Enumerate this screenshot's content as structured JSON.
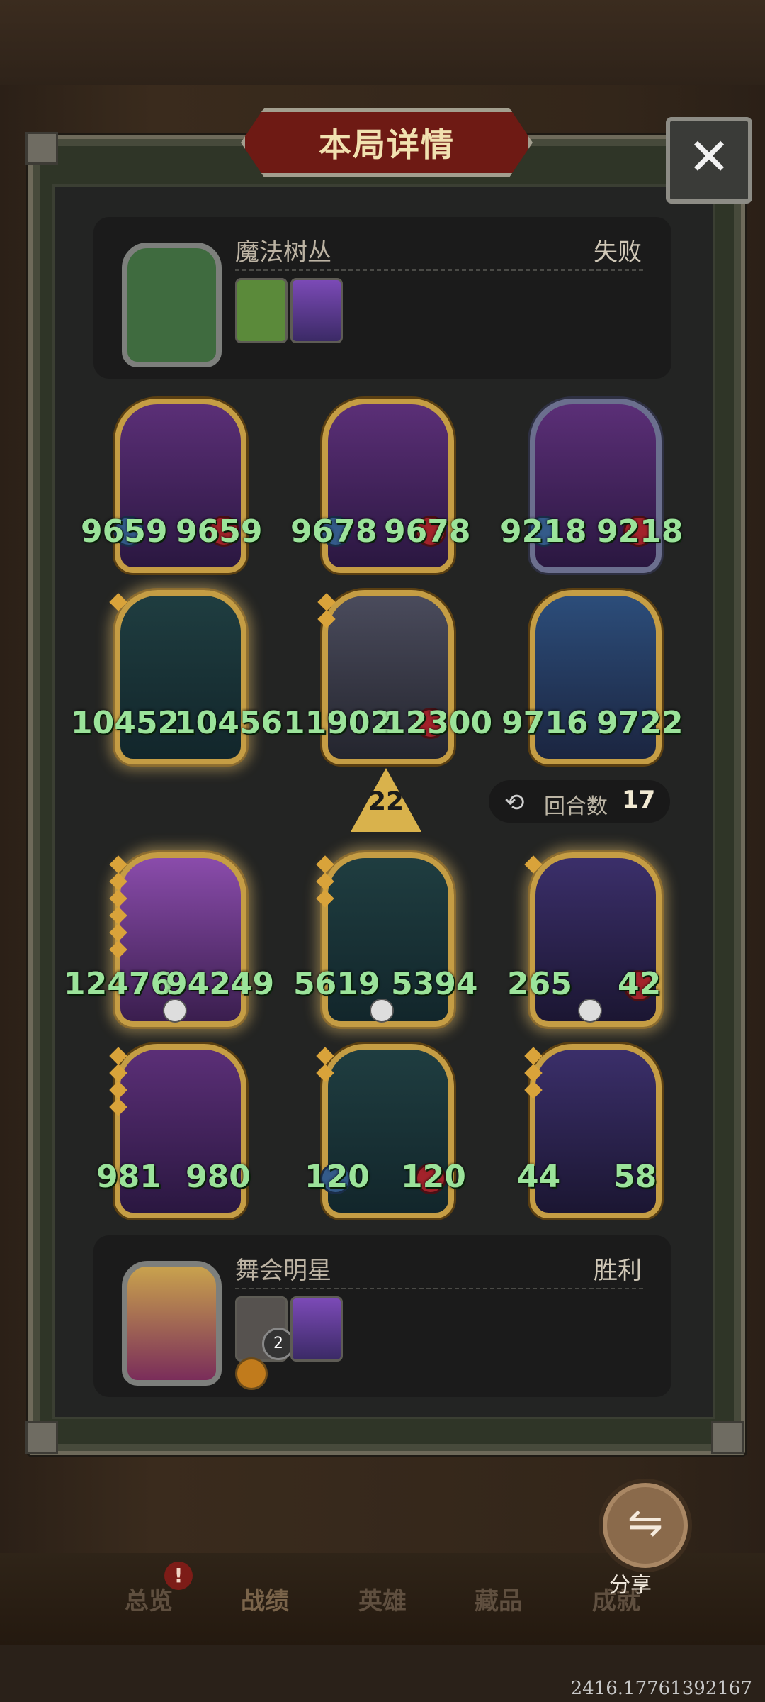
{
  "header": {
    "title": "本局详情",
    "close_label": "✕"
  },
  "opponent": {
    "name": "魔法树丛",
    "result": "失败"
  },
  "player": {
    "name": "舞会明星",
    "result": "胜利",
    "mini_badge": "2"
  },
  "units": {
    "opponent": [
      {
        "left": "9659",
        "right": "9659"
      },
      {
        "left": "9678",
        "right": "9678"
      },
      {
        "left": "9218",
        "right": "9218"
      },
      {
        "left": "10452",
        "right": "10456"
      },
      {
        "left": "11902",
        "right": "12300"
      },
      {
        "left": "9716",
        "right": "9722"
      }
    ],
    "player": [
      {
        "left": "12476",
        "right": "94249"
      },
      {
        "left": "5619",
        "right": "5394"
      },
      {
        "left": "265",
        "right": "42"
      },
      {
        "left": "981",
        "right": "980"
      },
      {
        "left": "120",
        "right": "120"
      },
      {
        "left": "44",
        "right": "58"
      }
    ]
  },
  "battle": {
    "level": "22",
    "round_label": "回合数",
    "round_value": "17"
  },
  "share": {
    "label": "分享"
  },
  "tabs": [
    "总览",
    "战绩",
    "英雄",
    "藏品",
    "成就"
  ],
  "notification": "!",
  "footer_coord": "2416.17761392167"
}
